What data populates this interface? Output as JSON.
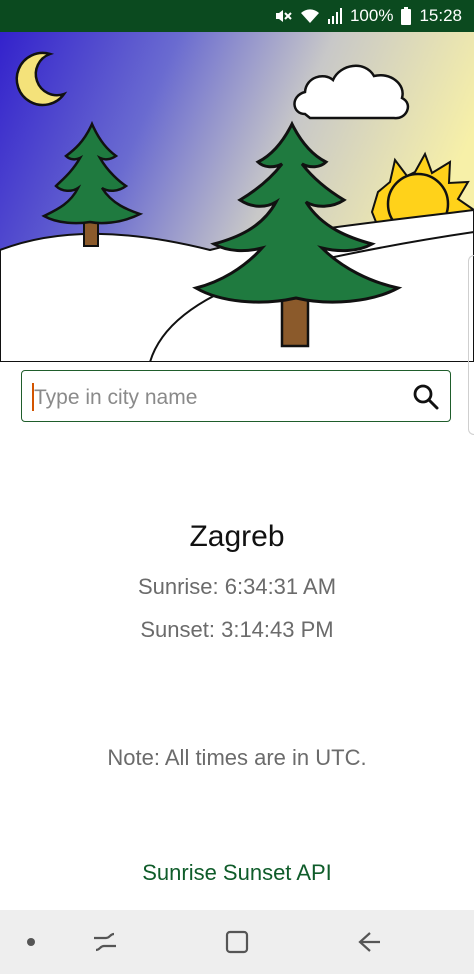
{
  "status_bar": {
    "battery": "100%",
    "time": "15:28",
    "icons": [
      "mute-icon",
      "wifi-icon",
      "signal-icon",
      "battery-icon"
    ]
  },
  "search": {
    "placeholder": "Type in city name",
    "value": ""
  },
  "result": {
    "city": "Zagreb",
    "sunrise": "Sunrise: 6:34:31 AM",
    "sunset": "Sunset: 3:14:43 PM"
  },
  "note": "Note: All times are in UTC.",
  "api_link": "Sunrise Sunset API",
  "colors": {
    "status_bar": "#0b4a1f",
    "accent_green": "#0f5c2a",
    "tree": "#1f7a3f",
    "sun": "#ffd21a",
    "sky_night": "#3a2bd1",
    "sky_day": "#f6f0b0"
  },
  "nav": {
    "icons": [
      "dot-icon",
      "recent-apps-icon",
      "home-icon",
      "back-icon"
    ]
  }
}
